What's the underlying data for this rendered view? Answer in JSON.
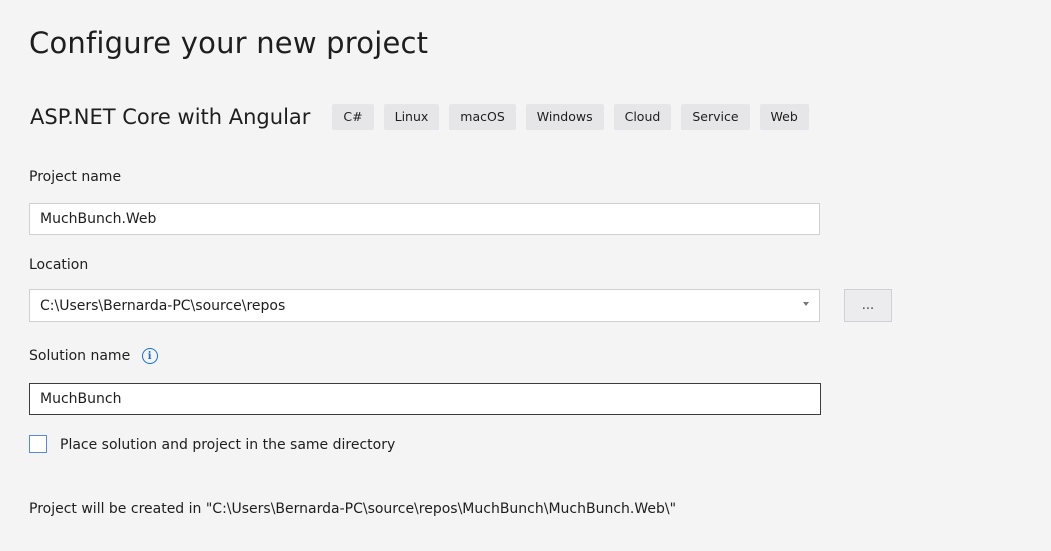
{
  "title": "Configure your new project",
  "template": {
    "name": "ASP.NET Core with Angular",
    "tags": [
      "C#",
      "Linux",
      "macOS",
      "Windows",
      "Cloud",
      "Service",
      "Web"
    ]
  },
  "project_name": {
    "label": "Project name",
    "value": "MuchBunch.Web"
  },
  "location": {
    "label": "Location",
    "value": "C:\\Users\\Bernarda-PC\\source\\repos",
    "browse_label": "..."
  },
  "solution_name": {
    "label": "Solution name",
    "info_glyph": "i",
    "value": "MuchBunch"
  },
  "same_directory": {
    "label": "Place solution and project in the same directory",
    "checked": false
  },
  "path_note": "Project will be created in \"C:\\Users\\Bernarda-PC\\source\\repos\\MuchBunch\\MuchBunch.Web\\\"",
  "colors": {
    "background": "#f4f4f5",
    "accent": "#1a6fd1"
  }
}
